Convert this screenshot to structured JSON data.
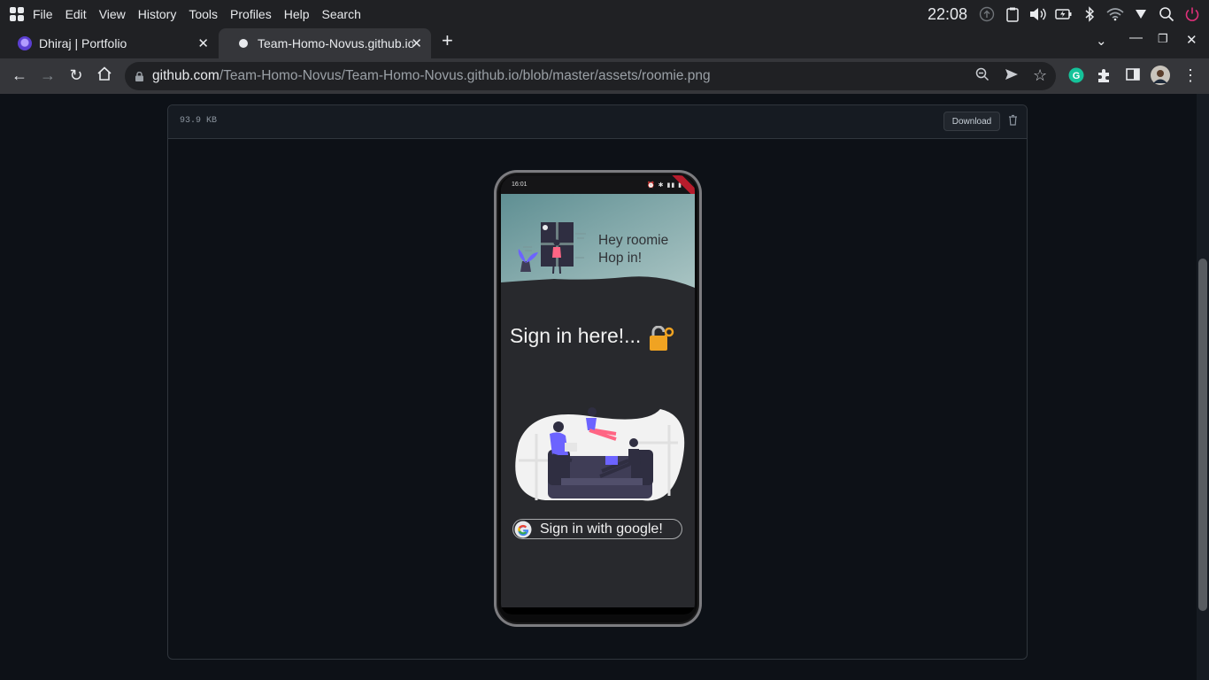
{
  "os_menubar": {
    "items": [
      "File",
      "Edit",
      "View",
      "History",
      "Tools",
      "Profiles",
      "Help",
      "Search"
    ],
    "clock": "22:08"
  },
  "tabs": [
    {
      "title": "Dhiraj | Portfolio",
      "active": false
    },
    {
      "title": "Team-Homo-Novus.github.io",
      "active": true
    }
  ],
  "address_bar": {
    "host": "github.com",
    "path": "/Team-Homo-Novus/Team-Homo-Novus.github.io/blob/master/assets/roomie.png"
  },
  "file_view": {
    "file_size": "93.9 KB",
    "download_label": "Download"
  },
  "phone_screen": {
    "status_time": "16:01",
    "greeting_line1": "Hey roomie",
    "greeting_line2": "Hop in!",
    "title": "Sign in here!...",
    "google_button_label": "Sign in with google!"
  },
  "colors": {
    "page_bg": "#0d1117",
    "browser_chrome": "#35363a",
    "header_wave": "#7fa4a6",
    "phone_bg": "#28292d"
  }
}
